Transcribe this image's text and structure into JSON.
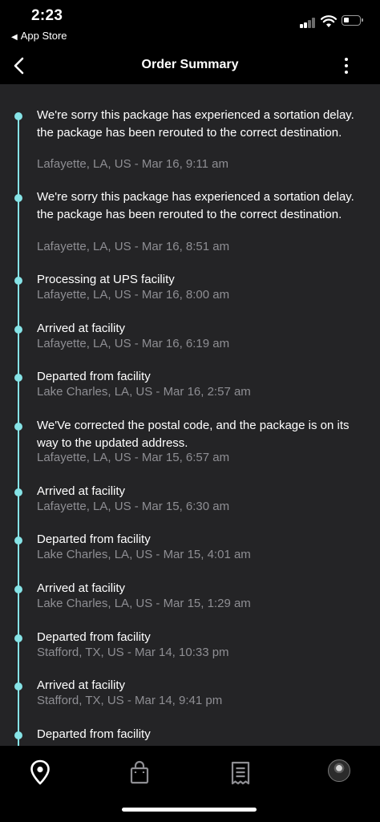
{
  "status": {
    "time": "2:23",
    "back_app": "App Store"
  },
  "header": {
    "title": "Order Summary"
  },
  "colors": {
    "accent": "#86e3e6",
    "background": "#242426",
    "meta_text": "#8e8e93"
  },
  "events": [
    {
      "title": "We're sorry this package has experienced a sortation delay. the package has been rerouted to the correct destination.",
      "meta": "Lafayette, LA, US - Mar 16, 9:11 am"
    },
    {
      "title": "We're sorry this package has experienced a sortation delay. the package has been rerouted to the correct destination.",
      "meta": "Lafayette, LA, US - Mar 16, 8:51 am"
    },
    {
      "title": "Processing at UPS facility",
      "meta": "Lafayette, LA, US - Mar 16, 8:00 am"
    },
    {
      "title": "Arrived at facility",
      "meta": "Lafayette, LA, US - Mar 16, 6:19 am"
    },
    {
      "title": "Departed from facility",
      "meta": "Lake Charles, LA, US - Mar 16, 2:57 am"
    },
    {
      "title": "We'Ve corrected the postal code, and the package is on its way to the updated address.",
      "meta": "Lafayette, LA, US - Mar 15, 6:57 am"
    },
    {
      "title": "Arrived at facility",
      "meta": "Lafayette, LA, US - Mar 15, 6:30 am"
    },
    {
      "title": "Departed from facility",
      "meta": "Lake Charles, LA, US - Mar 15, 4:01 am"
    },
    {
      "title": "Arrived at facility",
      "meta": "Lake Charles, LA, US - Mar 15, 1:29 am"
    },
    {
      "title": "Departed from facility",
      "meta": "Stafford, TX, US - Mar 14, 10:33 pm"
    },
    {
      "title": "Arrived at facility",
      "meta": "Stafford, TX, US - Mar 14, 9:41 pm"
    },
    {
      "title": "Departed from facility",
      "meta": ""
    }
  ],
  "tabs": [
    {
      "icon": "location-pin-icon"
    },
    {
      "icon": "shopping-bag-icon"
    },
    {
      "icon": "receipt-icon"
    },
    {
      "icon": "avatar"
    }
  ]
}
